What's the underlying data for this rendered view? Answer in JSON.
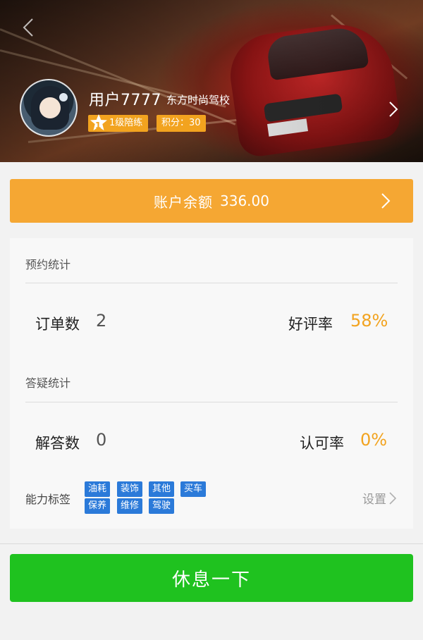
{
  "profile": {
    "username": "用户7777",
    "school": "东方时尚驾校",
    "level_number": "1",
    "level_label": "1级陪练",
    "points_label": "积分：30"
  },
  "balance": {
    "label": "账户余额",
    "amount": "336.00"
  },
  "booking_stats": {
    "title": "预约统计",
    "orders_label": "订单数",
    "orders_value": "2",
    "rating_label": "好评率",
    "rating_value": "58%"
  },
  "qa_stats": {
    "title": "答疑统计",
    "answers_label": "解答数",
    "answers_value": "0",
    "approval_label": "认可率",
    "approval_value": "0%"
  },
  "abilities": {
    "label": "能力标签",
    "tags": [
      "油耗",
      "装饰",
      "其他",
      "买车",
      "保养",
      "维修",
      "驾驶"
    ],
    "settings_label": "设置"
  },
  "rest_button": {
    "label": "休息一下"
  },
  "colors": {
    "accent_orange": "#f5a733",
    "tag_blue": "#2b7ad9",
    "rest_green": "#1fc21f"
  }
}
